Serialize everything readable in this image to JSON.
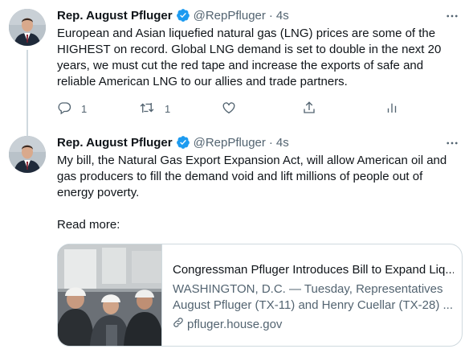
{
  "tweets": [
    {
      "author": "Rep. August Pfluger",
      "handle": "@RepPfluger",
      "separator": "·",
      "time": "4s",
      "text": "European and Asian liquefied natural gas (LNG) prices are some of the\nHIGHEST on record. Global LNG demand is set to double in the next 20\nyears, we must cut the red tape and increase the exports of safe and\nreliable American LNG to our allies and trade partners.",
      "reply_count": "1",
      "retweet_count": "1"
    },
    {
      "author": "Rep. August Pfluger",
      "handle": "@RepPfluger",
      "separator": "·",
      "time": "4s",
      "text": "My bill, the Natural Gas Export Expansion Act, will allow American oil and\ngas producers to fill the demand void and lift millions of people out of\nenergy poverty.\n\nRead more:",
      "card": {
        "title": "Congressman Pfluger Introduces Bill to Expand Liq...",
        "description": "WASHINGTON, D.C. — Tuesday, Representatives\nAugust Pfluger (TX-11) and Henry Cuellar (TX-28) ...",
        "domain": "pfluger.house.gov"
      }
    }
  ],
  "colors": {
    "verified": "#1d9bf0",
    "secondary_text": "#536471",
    "primary_text": "#0f1419",
    "border": "#cfd9de"
  },
  "icons": [
    "verified-badge-icon",
    "more-icon",
    "reply-icon",
    "retweet-icon",
    "like-icon",
    "share-icon",
    "analytics-icon",
    "link-icon"
  ]
}
